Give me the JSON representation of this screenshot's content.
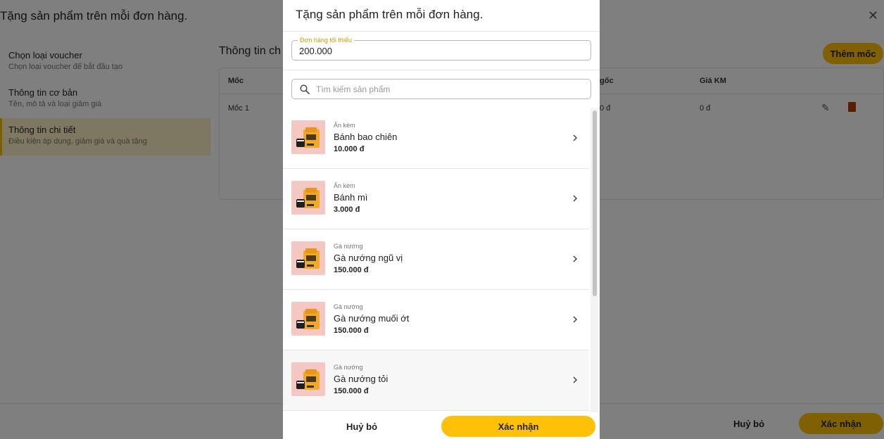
{
  "background": {
    "title": "Tặng sản phẩm trên mỗi đơn hàng.",
    "close_glyph": "✕",
    "steps": [
      {
        "title": "Chọn loại voucher",
        "desc": "Chọn loại voucher để bắt đầu tạo"
      },
      {
        "title": "Thông tin cơ bản",
        "desc": "Tên, mô tả và loại giảm giá"
      },
      {
        "title": "Thông tin chi tiết",
        "desc": "Điều kiện áp dụng, giảm giá và quà tặng"
      }
    ],
    "section_title": "Thông tin ch",
    "add_button": "Thêm mốc",
    "table": {
      "col_moc": "Mốc",
      "col_goc": "gốc",
      "col_gia_km": "Giá KM",
      "row_moc": "Mốc 1",
      "row_goc": "0 đ",
      "row_gia_km": "0 đ"
    },
    "footer": {
      "cancel": "Huỷ bỏ",
      "confirm": "Xác nhận"
    }
  },
  "modal": {
    "title": "Tặng sản phẩm trên mỗi đơn hàng.",
    "min_order": {
      "label": "Đơn hàng tối thiểu",
      "value": "200.000"
    },
    "search": {
      "placeholder": "Tìm kiếm sản phẩm"
    },
    "products": [
      {
        "category": "Ăn kèm",
        "name": "Bánh bao chiên",
        "price": "10.000 đ"
      },
      {
        "category": "Ăn kèm",
        "name": "Bánh mì",
        "price": "3.000 đ"
      },
      {
        "category": "Gà nướng",
        "name": "Gà nướng ngũ vị",
        "price": "150.000 đ"
      },
      {
        "category": "Gà nướng",
        "name": "Gà nướng muối ớt",
        "price": "150.000 đ"
      },
      {
        "category": "Gà nướng",
        "name": "Gà nướng tỏi",
        "price": "150.000 đ"
      }
    ],
    "footer": {
      "cancel": "Huỷ bỏ",
      "confirm": "Xác nhận"
    }
  },
  "colors": {
    "accent": "#ffc107",
    "thumb_bg": "#f4c7c3",
    "active_step_bg": "#fdf1c4"
  }
}
